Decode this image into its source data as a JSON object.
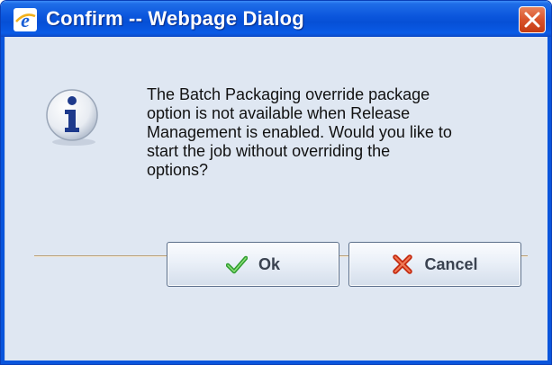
{
  "window": {
    "title": "Confirm -- Webpage Dialog"
  },
  "dialog": {
    "message": "The Batch Packaging override package\noption is not available when Release\nManagement is enabled. Would you like to\nstart the job without overriding the\noptions?"
  },
  "buttons": {
    "ok_label": "Ok",
    "cancel_label": "Cancel"
  },
  "icons": {
    "app": "internet-explorer-icon",
    "close": "close-icon",
    "info": "information-icon",
    "ok": "green-checkmark-icon",
    "cancel": "red-x-icon"
  },
  "colors": {
    "titlebar": "#0a55dc",
    "background": "#dfe7f2",
    "close_button": "#d9532b"
  }
}
